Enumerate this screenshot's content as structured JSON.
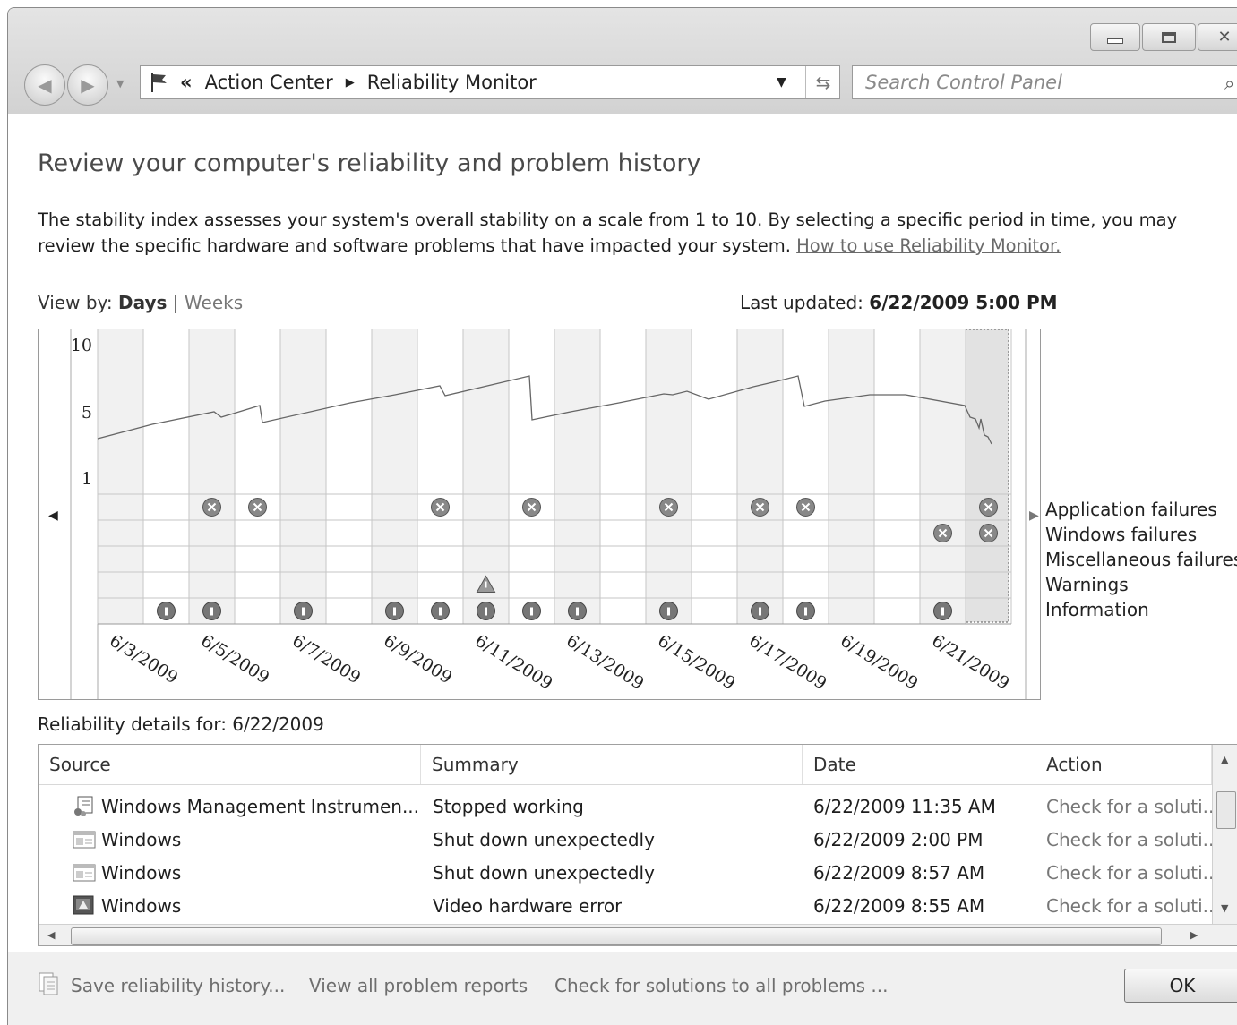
{
  "window": {
    "breadcrumb": [
      "Action Center",
      "Reliability Monitor"
    ],
    "breadcrumb_overflow": "«",
    "search_placeholder": "Search Control Panel"
  },
  "page": {
    "heading": "Review your computer's reliability and problem history",
    "description": "The stability index assesses your system's overall stability on a scale from 1 to 10. By selecting a specific period in time, you may review the specific hardware and software problems that have impacted your system.",
    "help_link": "How to use Reliability Monitor.",
    "view_by_label": "View by:",
    "view_days": "Days",
    "view_separator": "|",
    "view_weeks": "Weeks",
    "last_updated_label": "Last updated:",
    "last_updated_value": "6/22/2009 5:00 PM"
  },
  "chart": {
    "y_ticks": [
      "10",
      "5",
      "1"
    ],
    "dates": [
      "6/3/2009",
      "6/4/2009",
      "6/5/2009",
      "6/6/2009",
      "6/7/2009",
      "6/8/2009",
      "6/9/2009",
      "6/10/2009",
      "6/11/2009",
      "6/12/2009",
      "6/13/2009",
      "6/14/2009",
      "6/15/2009",
      "6/16/2009",
      "6/17/2009",
      "6/18/2009",
      "6/19/2009",
      "6/20/2009",
      "6/21/2009",
      "6/22/2009"
    ],
    "x_labels": [
      "6/3/2009",
      "6/5/2009",
      "6/7/2009",
      "6/9/2009",
      "6/11/2009",
      "6/13/2009",
      "6/15/2009",
      "6/17/2009",
      "6/19/2009",
      "6/21/2009"
    ],
    "selected_date": "6/22/2009",
    "legend": [
      "Application failures",
      "Windows failures",
      "Miscellaneous failures",
      "Warnings",
      "Information"
    ],
    "events": {
      "application_failures": [
        "6/5/2009",
        "6/6/2009",
        "6/10/2009",
        "6/12/2009",
        "6/15/2009",
        "6/17/2009",
        "6/18/2009",
        "6/22/2009"
      ],
      "windows_failures": [
        "6/21/2009",
        "6/22/2009"
      ],
      "misc_failures": [],
      "warnings": [
        "6/11/2009"
      ],
      "information": [
        "6/4/2009",
        "6/5/2009",
        "6/7/2009",
        "6/9/2009",
        "6/10/2009",
        "6/11/2009",
        "6/12/2009",
        "6/13/2009",
        "6/15/2009",
        "6/17/2009",
        "6/18/2009",
        "6/21/2009"
      ]
    }
  },
  "details": {
    "label": "Reliability details for: 6/22/2009",
    "columns": [
      "Source",
      "Summary",
      "Date",
      "Action"
    ],
    "rows": [
      {
        "icon": "wmi-icon",
        "source": "Windows Management Instrumen...",
        "summary": "Stopped working",
        "date": "6/22/2009 11:35 AM",
        "action": "Check for a soluti..."
      },
      {
        "icon": "windows-icon",
        "source": "Windows",
        "summary": "Shut down unexpectedly",
        "date": "6/22/2009 2:00 PM",
        "action": "Check for a soluti..."
      },
      {
        "icon": "windows-icon",
        "source": "Windows",
        "summary": "Shut down unexpectedly",
        "date": "6/22/2009 8:57 AM",
        "action": "Check for a soluti..."
      },
      {
        "icon": "video-hardware-icon",
        "source": "Windows",
        "summary": "Video hardware error",
        "date": "6/22/2009 8:55 AM",
        "action": "Check for a soluti..."
      }
    ]
  },
  "footer": {
    "save_history": "Save reliability history...",
    "view_all": "View all problem reports",
    "check_solutions": "Check for solutions to all problems ...",
    "ok": "OK"
  }
}
